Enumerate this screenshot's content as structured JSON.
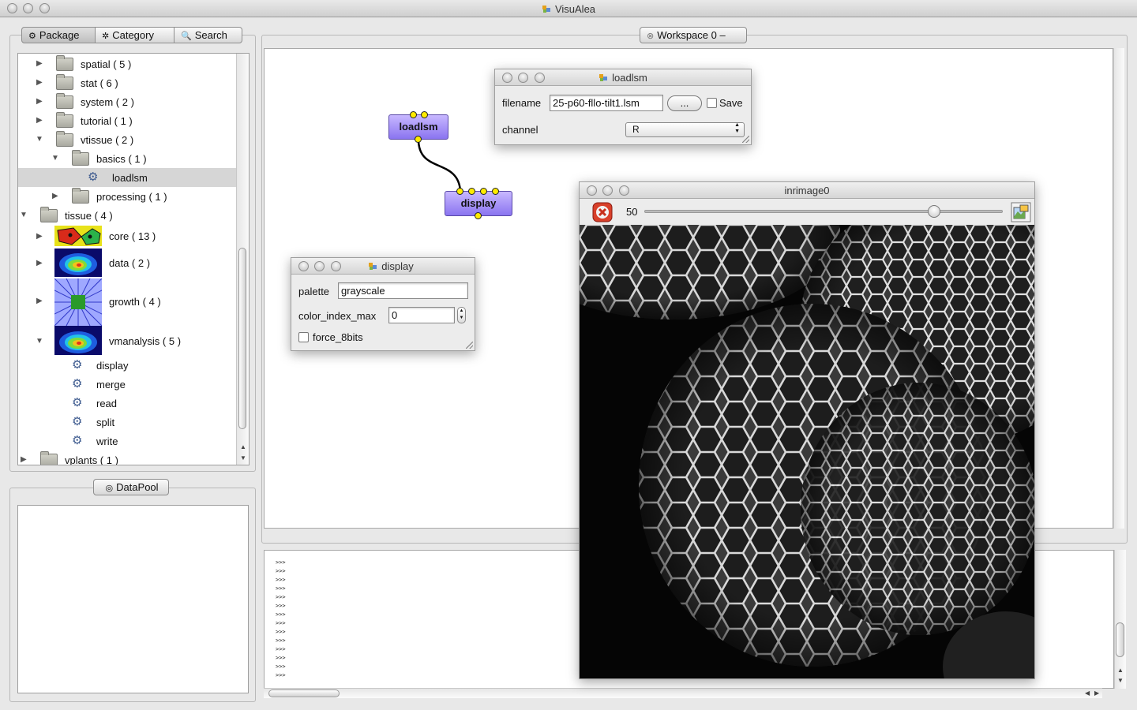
{
  "window": {
    "title": "VisuAlea"
  },
  "tabs": {
    "package": "Package",
    "category": "Category",
    "search": "Search"
  },
  "tree": {
    "items": [
      {
        "label": "spatial ( 5 )"
      },
      {
        "label": "stat ( 6 )"
      },
      {
        "label": "system ( 2 )"
      },
      {
        "label": "tutorial ( 1 )"
      },
      {
        "label": "vtissue ( 2 )"
      },
      {
        "label": "basics ( 1 )"
      },
      {
        "label": "loadlsm"
      },
      {
        "label": "processing ( 1 )"
      },
      {
        "label": "tissue ( 4 )"
      },
      {
        "label": "core ( 13 )"
      },
      {
        "label": "data ( 2 )"
      },
      {
        "label": "growth ( 4 )"
      },
      {
        "label": "vmanalysis ( 5 )"
      },
      {
        "label": "display"
      },
      {
        "label": "merge"
      },
      {
        "label": "read"
      },
      {
        "label": "split"
      },
      {
        "label": "write"
      },
      {
        "label": "vplants ( 1 )"
      }
    ]
  },
  "datapool": {
    "label": "DataPool"
  },
  "workspace": {
    "tab_label": "Workspace 0 –"
  },
  "nodes": {
    "loadlsm": "loadlsm",
    "display": "display"
  },
  "loadlsm_window": {
    "title": "loadlsm",
    "filename_label": "filename",
    "filename_value": "25-p60-fllo-tilt1.lsm",
    "browse_label": "...",
    "save_label": "Save",
    "channel_label": "channel",
    "channel_value": "R"
  },
  "display_window": {
    "title": "display",
    "palette_label": "palette",
    "palette_value": "grayscale",
    "color_index_max_label": "color_index_max",
    "color_index_max_value": "0",
    "force_8bits_label": "force_8bits"
  },
  "inrimage_window": {
    "title": "inrimage0",
    "slice_value": "50",
    "slider_fraction": 0.82
  },
  "console": {
    "prompt": ">>>"
  }
}
